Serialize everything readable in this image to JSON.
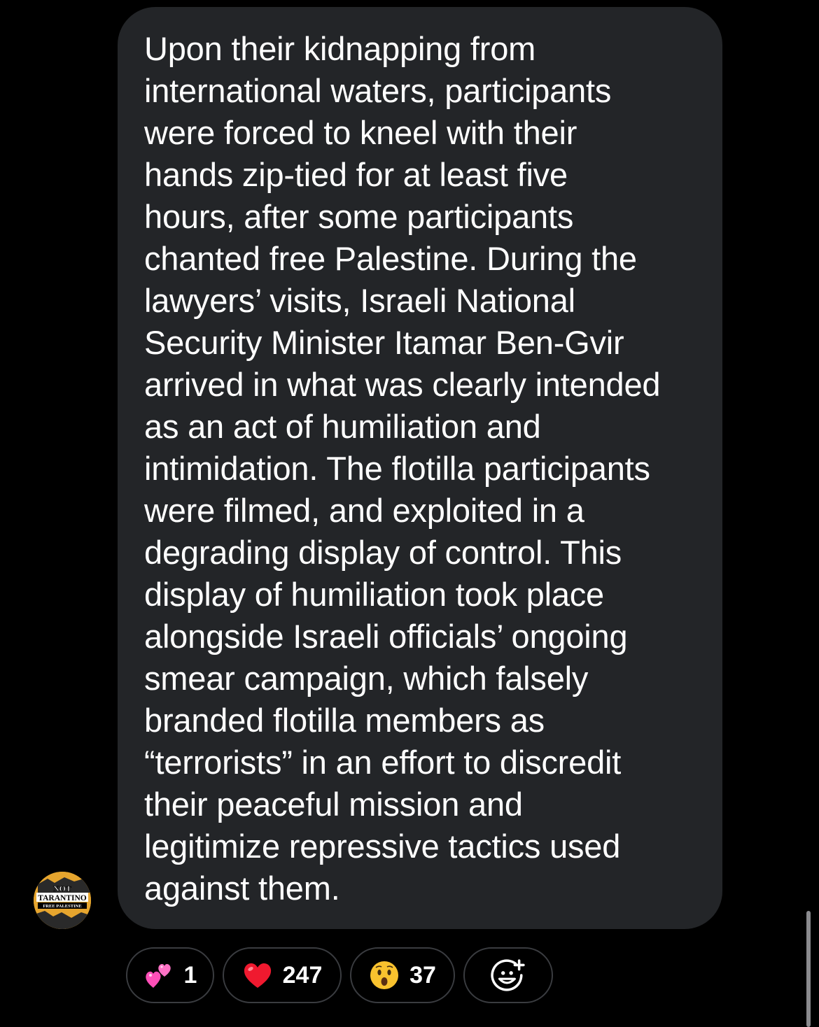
{
  "message": {
    "text": "Upon their kidnapping from\ninternational waters, participants\nwere forced to kneel with their\nhands zip-tied for at least five\nhours, after some participants\nchanted free Palestine. During the\nlawyers’ visits, Israeli National\nSecurity Minister Itamar Ben-Gvir\narrived in what was clearly intended\nas an act of humiliation and\nintimidation. The flotilla participants\nwere filmed, and exploited in a\ndegrading display of control. This\ndisplay of humiliation took place\nalongside Israeli officials’ ongoing\nsmear campaign, which falsely\nbranded flotilla members as\n“terrorists” in an effort to discredit\ntheir peaceful mission and\nlegitimize repressive tactics used\nagainst them."
  },
  "avatar": {
    "line1": "NOT",
    "line2": "TARANTINO",
    "line3": "FREE PALESTINE"
  },
  "reactions": [
    {
      "icon": "two-hearts-icon",
      "count": "1"
    },
    {
      "icon": "red-heart-icon",
      "count": "247"
    },
    {
      "icon": "surprised-face-icon",
      "count": "37"
    },
    {
      "icon": "add-reaction-icon",
      "count": ""
    }
  ],
  "colors": {
    "background": "#000000",
    "bubble": "#232528",
    "pill_border": "#3a3c40",
    "text": "#ffffff"
  }
}
